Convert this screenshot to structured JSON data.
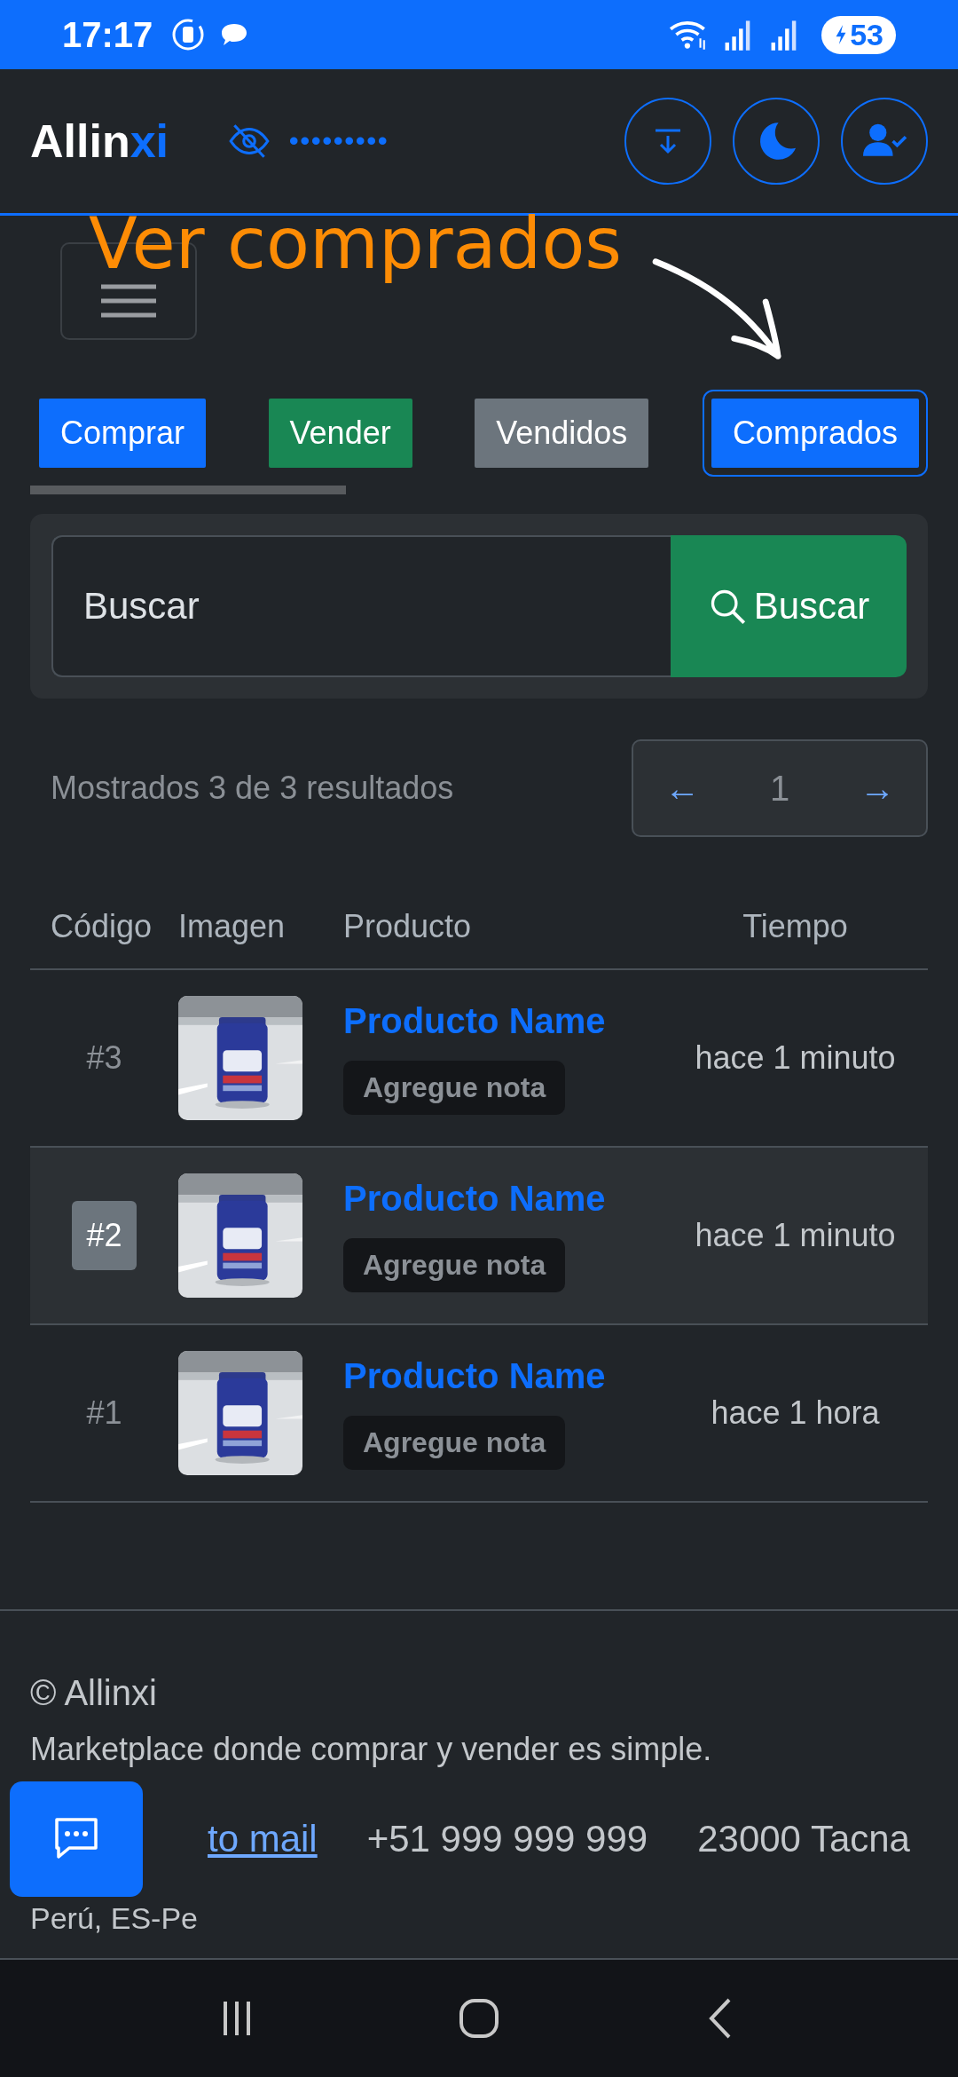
{
  "status_bar": {
    "time": "17:17",
    "battery": "53"
  },
  "header": {
    "logo_main": "Allin",
    "logo_accent": "xi",
    "masked_value": "•••••••••"
  },
  "annotation": {
    "text": "Ver comprados"
  },
  "tabs": [
    {
      "label": "Comprar",
      "color": "#0d6efd",
      "selected": false
    },
    {
      "label": "Vender",
      "color": "#198754",
      "selected": false
    },
    {
      "label": "Vendidos",
      "color": "#6c757d",
      "selected": false
    },
    {
      "label": "Comprados",
      "color": "#0d6efd",
      "selected": true
    }
  ],
  "search": {
    "placeholder": "Buscar",
    "button": "Buscar"
  },
  "results": {
    "summary": "Mostrados 3 de 3 resultados",
    "prev": "←",
    "page": "1",
    "next": "→"
  },
  "table": {
    "columns": [
      "Código",
      "Imagen",
      "Producto",
      "Tiempo"
    ],
    "rows": [
      {
        "code": "#3",
        "product": "Producto Name",
        "note": "Agregue nota",
        "time": "hace 1 minuto",
        "selected": false
      },
      {
        "code": "#2",
        "product": "Producto Name",
        "note": "Agregue nota",
        "time": "hace 1 minuto",
        "selected": true
      },
      {
        "code": "#1",
        "product": "Producto Name",
        "note": "Agregue nota",
        "time": "hace 1 hora",
        "selected": false
      }
    ]
  },
  "footer": {
    "copyright": "© Allinxi",
    "tagline": "Marketplace donde comprar y vender es simple.",
    "mail_link": "to mail",
    "phone": "+51 999 999 999",
    "address": "23000 Tacna",
    "address_line2": "Perú, ES-Pe"
  }
}
